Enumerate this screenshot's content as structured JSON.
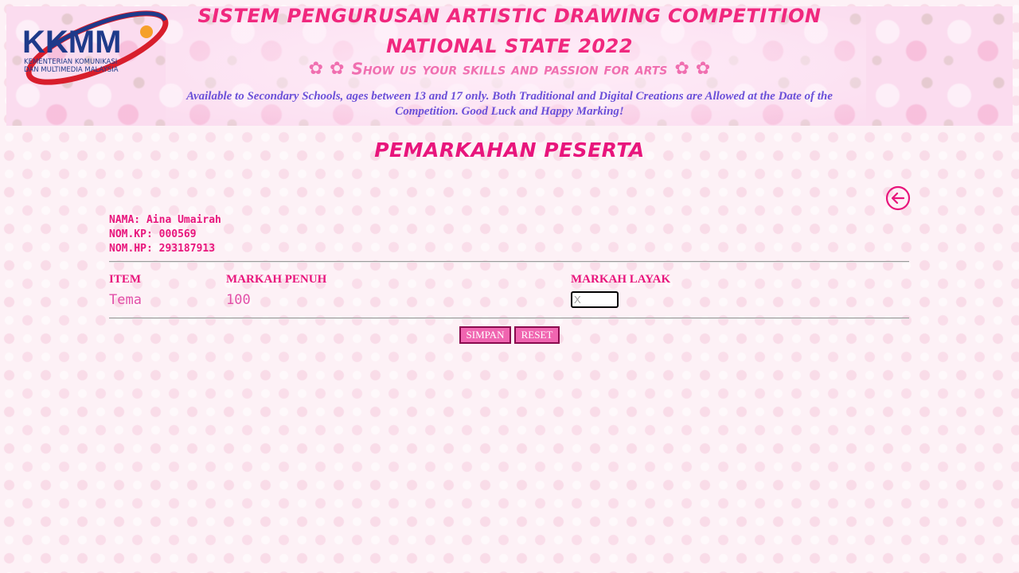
{
  "banner": {
    "logo_text": "KKMM",
    "logo_subtext_line1": "KEMENTERIAN KOMUNIKASI",
    "logo_subtext_line2": "DAN MULTIMEDIA MALAYSIA",
    "title_line1": "SISTEM PENGURUSAN ARTISTIC DRAWING COMPETITION",
    "title_line2": "NATIONAL STATE 2022",
    "tagline": "Show us your skills and passion for arts",
    "subtitle": "Available to Secondary Schools, ages between 13 and 17 only. Both Traditional and Digital Creations are Allowed at the Date of the Competition. Good Luck and Happy Marking!"
  },
  "page": {
    "title": "PEMARKAHAN PESERTA"
  },
  "participant": {
    "name": "NAMA: Aina Umairah",
    "ic": "NOM.KP: 000569",
    "phone": "NOM.HP: 293187913"
  },
  "table": {
    "headers": {
      "item": "ITEM",
      "full_score": "MARKAH PENUH",
      "earned_score": "MARKAH LAYAK"
    },
    "rows": [
      {
        "item": "Tema",
        "full_score": "100",
        "score_value": "",
        "score_placeholder": "X"
      }
    ]
  },
  "actions": {
    "save_label": "SIMPAN",
    "reset_label": "RESET"
  },
  "colors": {
    "accent": "#e8157c",
    "button_bg": "#f065b0",
    "subtitle": "#6a4fd8"
  },
  "icons": {
    "back": "arrow-left-circle-icon",
    "flower": "flower-icon"
  }
}
